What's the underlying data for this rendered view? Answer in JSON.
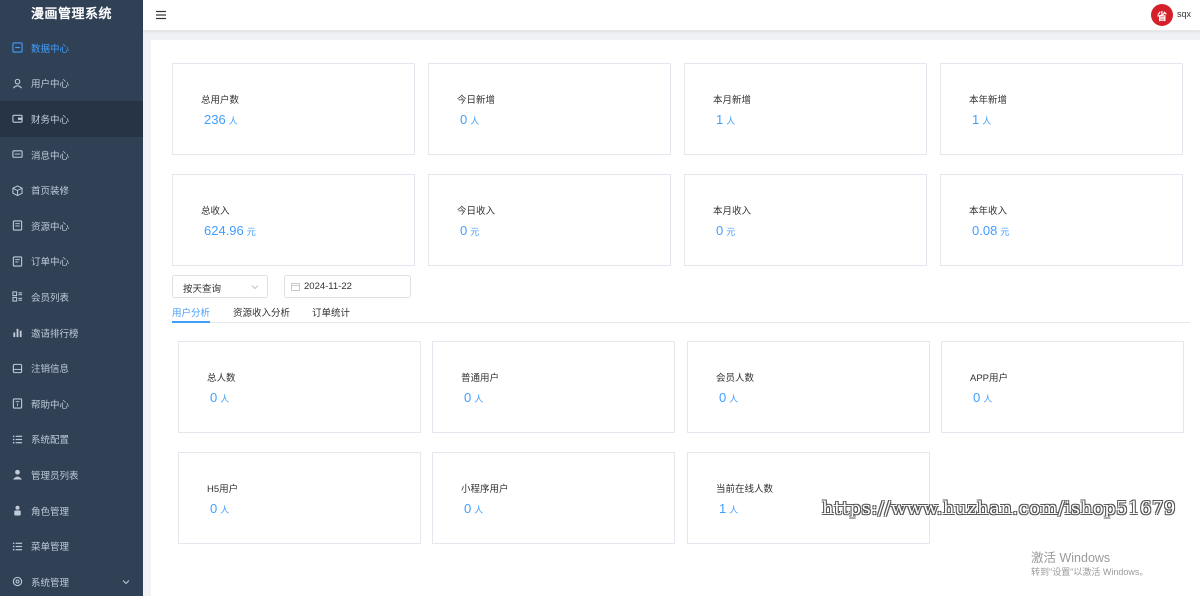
{
  "app": {
    "title": "漫画管理系统"
  },
  "sidebar": {
    "items": [
      {
        "label": "数据中心",
        "icon": "dashboard-icon"
      },
      {
        "label": "用户中心",
        "icon": "user-icon"
      },
      {
        "label": "财务中心",
        "icon": "wallet-icon"
      },
      {
        "label": "消息中心",
        "icon": "message-icon"
      },
      {
        "label": "首页装修",
        "icon": "box-icon"
      },
      {
        "label": "资源中心",
        "icon": "document-icon"
      },
      {
        "label": "订单中心",
        "icon": "order-icon"
      },
      {
        "label": "会员列表",
        "icon": "grid-icon"
      },
      {
        "label": "邀请排行榜",
        "icon": "chart-icon"
      },
      {
        "label": "注销信息",
        "icon": "disk-icon"
      },
      {
        "label": "帮助中心",
        "icon": "help-icon"
      },
      {
        "label": "系统配置",
        "icon": "list-icon"
      },
      {
        "label": "管理员列表",
        "icon": "person-icon"
      },
      {
        "label": "角色管理",
        "icon": "role-icon"
      },
      {
        "label": "菜单管理",
        "icon": "list-icon"
      },
      {
        "label": "系统管理",
        "icon": "settings-icon"
      }
    ]
  },
  "header": {
    "avatar_text": "省",
    "username": "sqx"
  },
  "stats_top": [
    {
      "label": "总用户数",
      "value": "236",
      "unit": "人"
    },
    {
      "label": "今日新增",
      "value": "0",
      "unit": "人"
    },
    {
      "label": "本月新增",
      "value": "1",
      "unit": "人"
    },
    {
      "label": "本年新增",
      "value": "1",
      "unit": "人"
    },
    {
      "label": "总收入",
      "value": "624.96",
      "unit": "元"
    },
    {
      "label": "今日收入",
      "value": "0",
      "unit": "元"
    },
    {
      "label": "本月收入",
      "value": "0",
      "unit": "元"
    },
    {
      "label": "本年收入",
      "value": "0.08",
      "unit": "元"
    }
  ],
  "filters": {
    "query_mode": "按天查询",
    "date": "2024-11-22"
  },
  "tabs": [
    {
      "label": "用户分析",
      "active": true
    },
    {
      "label": "资源收入分析",
      "active": false
    },
    {
      "label": "订单统计",
      "active": false
    }
  ],
  "stats_users": [
    {
      "label": "总人数",
      "value": "0",
      "unit": "人"
    },
    {
      "label": "普通用户",
      "value": "0",
      "unit": "人"
    },
    {
      "label": "会员人数",
      "value": "0",
      "unit": "人"
    },
    {
      "label": "APP用户",
      "value": "0",
      "unit": "人"
    },
    {
      "label": "H5用户",
      "value": "0",
      "unit": "人"
    },
    {
      "label": "小程序用户",
      "value": "0",
      "unit": "人"
    },
    {
      "label": "当前在线人数",
      "value": "1",
      "unit": "人"
    }
  ],
  "watermark": "https://www.huzhan.com/ishop51679",
  "windows_notice": {
    "line1": "激活 Windows",
    "line2": "转到\"设置\"以激活 Windows。"
  },
  "colors": {
    "sidebar_bg": "#304156",
    "accent": "#409eff",
    "sidebar_text": "#bfcbd9"
  }
}
